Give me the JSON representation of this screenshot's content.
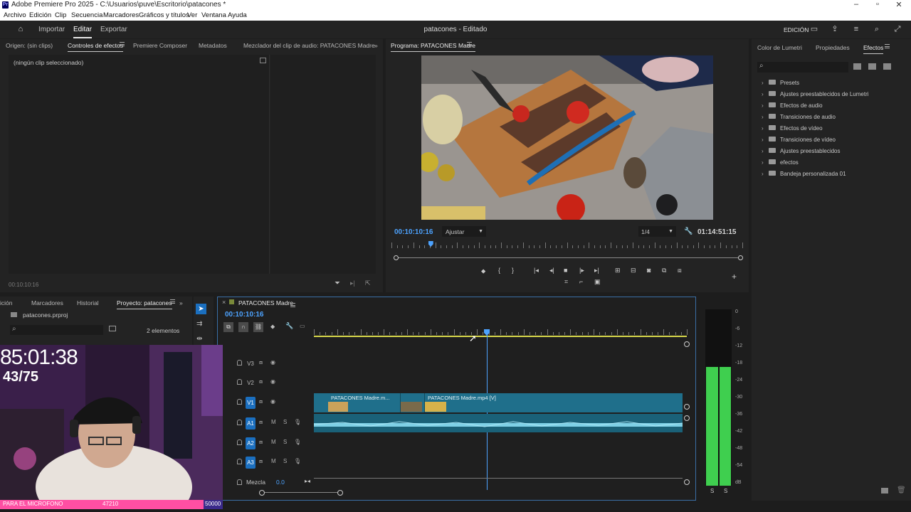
{
  "app": {
    "title": "Adobe Premiere Pro 2025 - C:\\Usuarios\\puve\\Escritorio\\patacones *",
    "logo": "Pr",
    "window_controls": [
      "minimize-icon",
      "maximize-icon",
      "close-icon"
    ]
  },
  "menu": [
    "Archivo",
    "Edición",
    "Clip",
    "Secuencia",
    "Marcadores",
    "Gráficos y títulos",
    "Ver",
    "Ventana",
    "Ayuda"
  ],
  "header": {
    "workspaces": [
      "Importar",
      "Editar",
      "Exportar"
    ],
    "active_workspace": "Editar",
    "document_title": "patacones - Editado",
    "workspace_label": "EDICIÓN"
  },
  "source_panel": {
    "tabs": [
      "Origen: (sin clips)",
      "Controles de efectos",
      "Premiere Composer",
      "Metadatos",
      "Mezclador del clip de audio: PATACONES Madre"
    ],
    "active_tab": "Controles de efectos",
    "empty_text": "(ningún clip seleccionado)",
    "timecode": "00:10:10:16"
  },
  "program_monitor": {
    "tab": "Programa: PATACONES Madre",
    "timecode_current": "00:10:10:16",
    "fit": "Ajustar",
    "resolution": "1/4",
    "timecode_duration": "01:14:51:15",
    "playhead_fraction": 0.111
  },
  "project_panel": {
    "tabs": [
      "ición",
      "Marcadores",
      "Historial",
      "Proyecto: patacones"
    ],
    "active_tab": "Proyecto: patacones",
    "file": "patacones.prproj",
    "count": "2 elementos"
  },
  "timeline": {
    "sequence": "PATACONES Madre",
    "timecode": "00:10:10:16",
    "tracks_video": [
      "V3",
      "V2",
      "V1"
    ],
    "tracks_audio": [
      "A1",
      "A2",
      "A3"
    ],
    "mix_label": "Mezcla",
    "mix_value": "0.0",
    "clips_video": [
      "PATACONES Madre.m...",
      "PATACONES Madre.mp4 [V]"
    ],
    "audio_mute": "M",
    "audio_solo": "S"
  },
  "meters": {
    "scale": [
      "0",
      "-6",
      "-12",
      "-18",
      "-24",
      "-30",
      "-36",
      "-42",
      "-48",
      "-54",
      "dB"
    ],
    "channels": [
      "S",
      "S"
    ],
    "level_fraction": 0.68
  },
  "effects_panel": {
    "tabs": [
      "Color de Lumetri",
      "Propiedades",
      "Efectos"
    ],
    "active_tab": "Efectos",
    "items": [
      "Presets",
      "Ajustes preestablecidos de Lumetri",
      "Efectos de audio",
      "Transiciones de audio",
      "Efectos de vídeo",
      "Transiciones de vídeo",
      "Ajustes preestablecidos",
      "efectos",
      "Bandeja personalizada 01"
    ]
  },
  "stream_overlay": {
    "timer": "85:01:38",
    "counter": "43/75",
    "bar_text": "PARA EL MICROFONO",
    "bar_value": "47210",
    "bar_goal": "50000"
  },
  "colors": {
    "accent_blue": "#1b6fbf",
    "timecode_blue": "#4da3ff",
    "clip_teal": "#1f6f8b",
    "meter_green": "#3fcf4f",
    "stream_pink": "#ff4fa3"
  }
}
